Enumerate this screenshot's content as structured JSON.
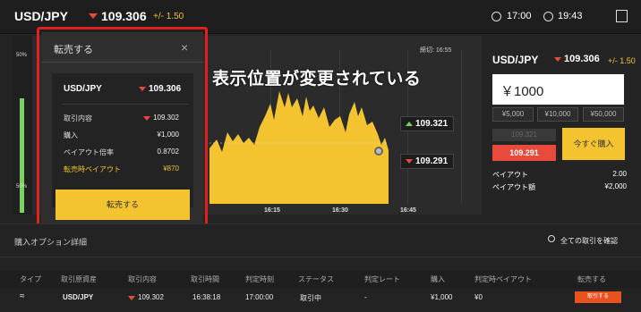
{
  "header": {
    "symbol": "USD/JPY",
    "price": "109.306",
    "change": "+/- 1.50",
    "time_left": "17:00",
    "time_right": "19:43"
  },
  "chart": {
    "scale_top": "50%",
    "scale_bottom": "50%",
    "close_label": "×",
    "judge_time": "締切: 16:55",
    "upper_price": "109.321",
    "lower_price": "109.291",
    "x_ticks": [
      "16:15",
      "16:30",
      "16:45"
    ],
    "overlay_text": "表示位置が変更されている"
  },
  "popup": {
    "title": "転売する",
    "close": "×",
    "symbol": "USD/JPY",
    "price": "109.306",
    "rows": [
      {
        "label": "取引内容",
        "value": "109.302"
      },
      {
        "label": "購入",
        "value": "¥1,000"
      },
      {
        "label": "ペイアウト倍率",
        "value": "0.8702"
      },
      {
        "label": "転売時ペイアウト",
        "value": "¥870"
      }
    ],
    "button": "転売する"
  },
  "panel": {
    "symbol": "USD/JPY",
    "price": "109.306",
    "change": "+/- 1.50",
    "amount": "￥1000",
    "presets": [
      "¥5,000",
      "¥10,000",
      "¥50,000"
    ],
    "high_price": "109.321",
    "low_price": "109.291",
    "buy_button": "今すぐ購入",
    "payout_label": "ペイアウト",
    "payout_value": "2.00",
    "payout_amount_label": "ペイアウト額",
    "payout_amount_value": "¥2,000"
  },
  "bottom": {
    "title": "購入オプション詳細",
    "all_trades": "全ての取引を確認",
    "columns": [
      "タイプ",
      "取引原資産",
      "取引内容",
      "取引時間",
      "判定時刻",
      "ステータス",
      "判定レート",
      "購入",
      "判定時ペイアウト",
      "転売する"
    ],
    "row": {
      "asset": "USD/JPY",
      "content": "109.302",
      "time": "16:38:18",
      "judge": "17:00:00",
      "status": "取引中",
      "rate": "-",
      "buy": "¥1,000",
      "payout": "¥0",
      "button": "取引する"
    }
  },
  "colors": {
    "accent_yellow": "#f4c430",
    "down_red": "#e84a3c",
    "up_green": "#7bd25e",
    "highlight_border": "#e0211d"
  }
}
